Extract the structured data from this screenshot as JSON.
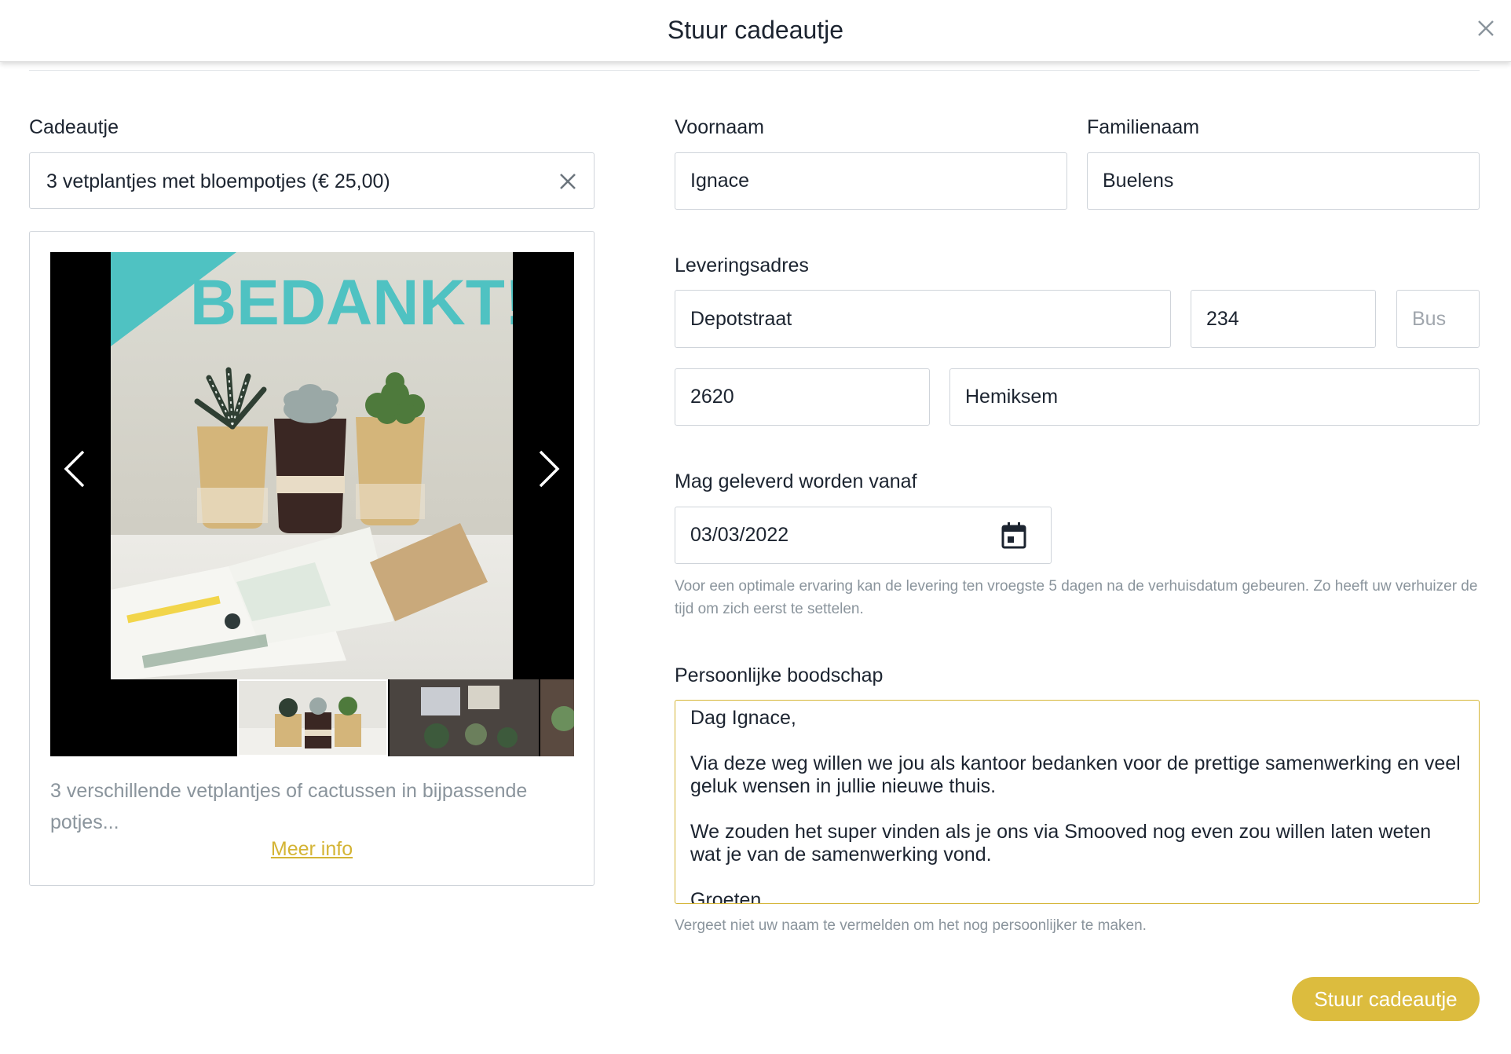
{
  "header": {
    "title": "Stuur cadeautje"
  },
  "gift": {
    "label": "Cadeautje",
    "selected": "3 vetplantjes met bloempotjes (€ 25,00)",
    "image_text": "BEDANKT!",
    "description": "3 verschillende vetplantjes of cactussen in bijpassende potjes...",
    "more_info": "Meer info"
  },
  "form": {
    "firstname_label": "Voornaam",
    "firstname_value": "Ignace",
    "lastname_label": "Familienaam",
    "lastname_value": "Buelens",
    "address_label": "Leveringsadres",
    "street_value": "Depotstraat",
    "number_value": "234",
    "bus_placeholder": "Bus",
    "zip_value": "2620",
    "city_value": "Hemiksem",
    "date_label": "Mag geleverd worden vanaf",
    "date_value": "03/03/2022",
    "date_hint": "Voor een optimale ervaring kan de levering ten vroegste 5 dagen na de verhuisdatum gebeuren. Zo heeft uw verhuizer de tijd om zich eerst te settelen.",
    "message_label": "Persoonlijke boodschap",
    "message_value": "Dag Ignace,\n\nVia deze weg willen we jou als kantoor bedanken voor de prettige samenwerking en veel geluk wensen in jullie nieuwe thuis.\n\nWe zouden het super vinden als je ons via Smooved nog even zou willen laten weten wat je van de samenwerking vond.\n\nGroeten",
    "message_hint": "Vergeet niet uw naam te vermelden om het nog persoonlijker te maken."
  },
  "actions": {
    "submit_label": "Stuur cadeautje"
  },
  "colors": {
    "accent": "#dcbc3e",
    "link": "#d4b435",
    "teal": "#4fc2c2"
  }
}
